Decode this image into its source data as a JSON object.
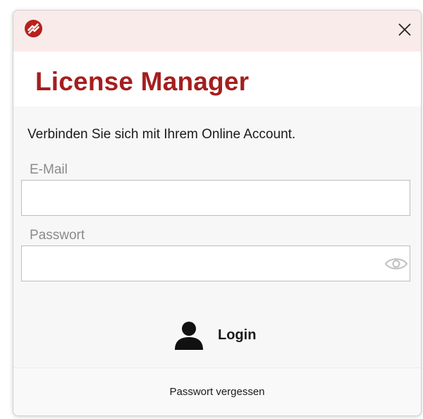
{
  "window": {
    "app_icon": "app-logo-icon",
    "close_icon": "close-icon",
    "title": "License Manager"
  },
  "form": {
    "subtitle": "Verbinden Sie sich mit Ihrem Online Account.",
    "email_label": "E-Mail",
    "email_value": "",
    "password_label": "Passwort",
    "password_value": "",
    "password_toggle_icon": "eye-icon"
  },
  "actions": {
    "login_icon": "user-icon",
    "login_label": "Login",
    "forgot_password": "Passwort vergessen"
  },
  "colors": {
    "title": "#a51e1e",
    "titlebar_bg": "#f9ebea",
    "window_bg": "#f7f7f7"
  }
}
